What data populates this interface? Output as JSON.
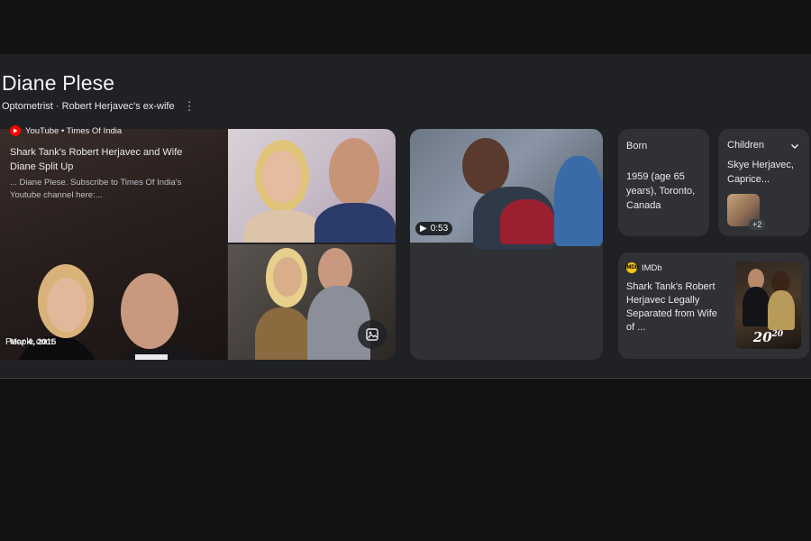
{
  "header": {
    "title": "Diane Plese",
    "subtitle": "Optometrist · Robert Herjavec's ex-wife",
    "more_icon": "more-vert-icon"
  },
  "images": {
    "main_source": "People.com",
    "image_search_icon": "image-icon"
  },
  "video": {
    "duration": "0:53",
    "source": "YouTube • Times Of India",
    "title": "Shark Tank's Robert Herjavec and Wife Diane Split Up",
    "snippet": "... Diane Plese. Subscribe to Times Of India's Youtube channel here:...",
    "date": "Mar 4, 2015",
    "play_icon": "play-icon"
  },
  "born": {
    "label": "Born",
    "value": "1959 (age 65 years), Toronto, Canada"
  },
  "children": {
    "label": "Children",
    "value": "Skye Herjavec, Caprice...",
    "more_count": "+2",
    "expand_icon": "chevron-down-icon"
  },
  "imdb": {
    "source": "IMDb",
    "title": "Shark Tank's Robert Herjavec Legally Separated from Wife of ...",
    "thumb_logo": "20/20"
  },
  "colors": {
    "page_background": "#141112",
    "panel_background": "#202124",
    "card_background": "#303134",
    "youtube_red": "#ff0000",
    "imdb_yellow": "#f5c518"
  }
}
